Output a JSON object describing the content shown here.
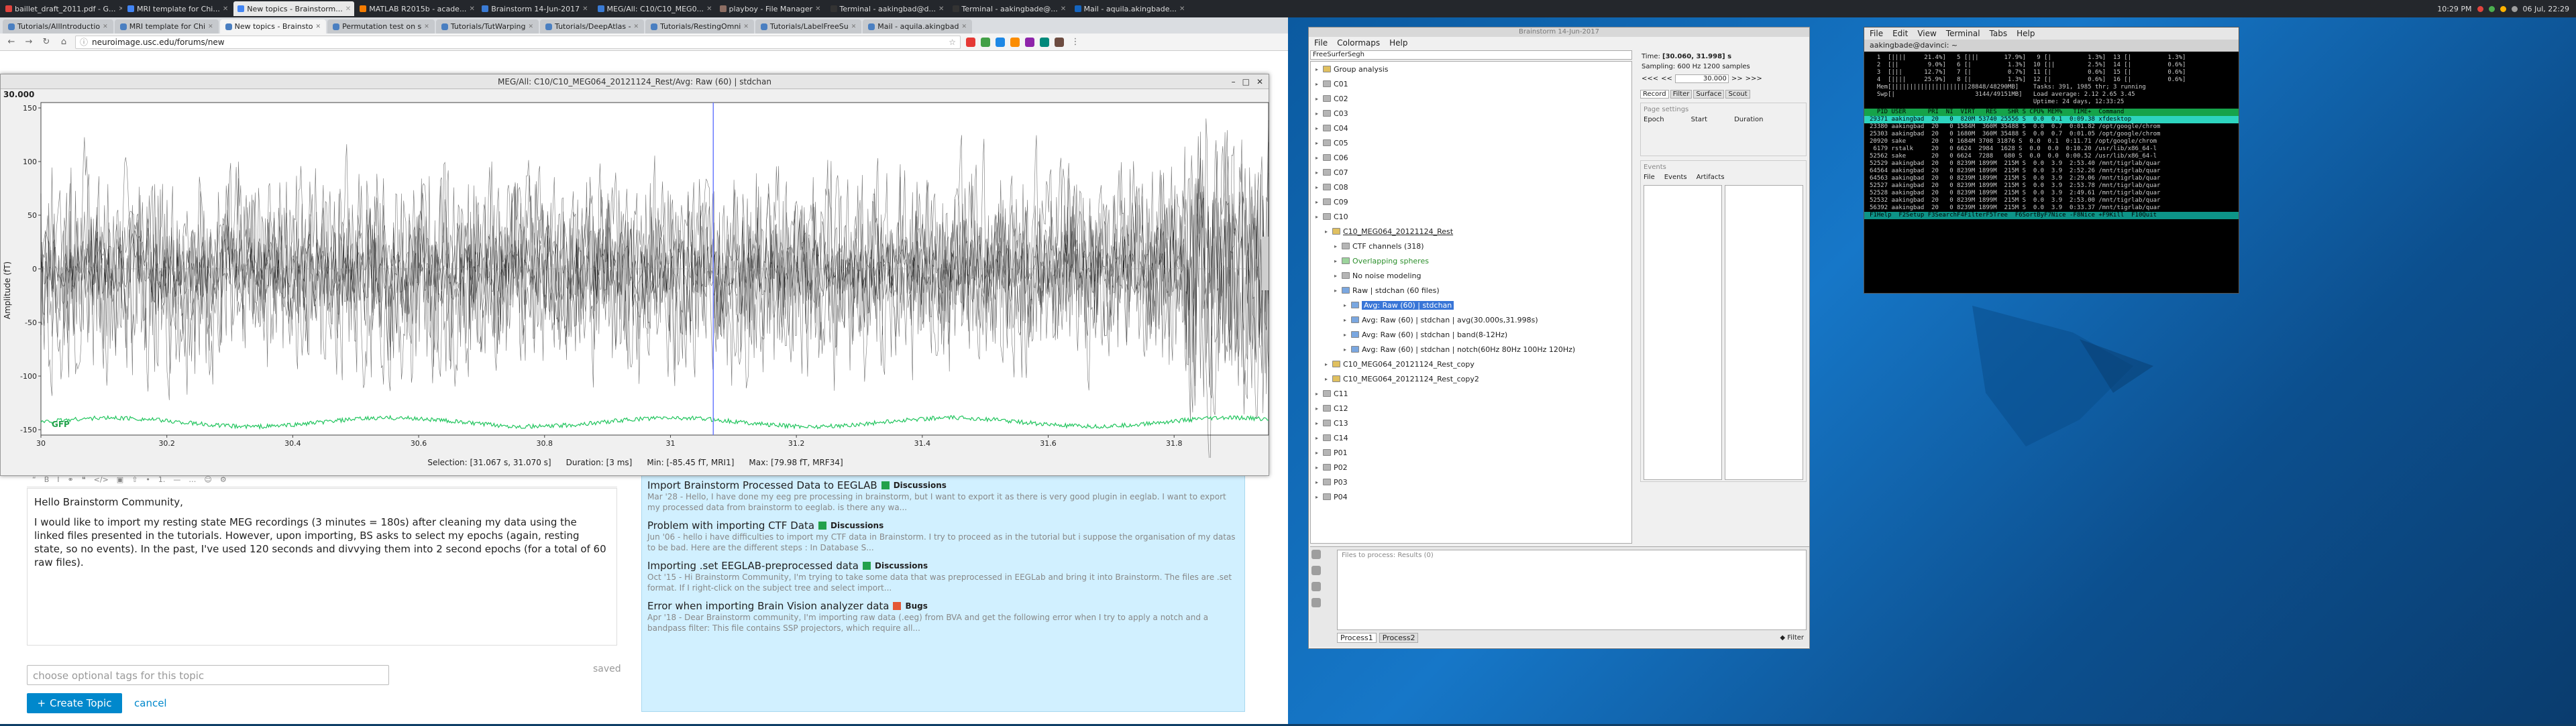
{
  "taskbar": {
    "tabs": [
      {
        "label": "baillet_draft_2011.pdf - G...",
        "color": "#e0443e",
        "active": false
      },
      {
        "label": "MRI template for Chi...",
        "color": "#4285f4",
        "active": false
      },
      {
        "label": "New topics - Brainstorm...",
        "color": "#4285f4",
        "active": true
      },
      {
        "label": "MATLAB R2015b - acade...",
        "color": "#f57c00",
        "active": false
      },
      {
        "label": "Brainstorm 14-Jun-2017",
        "color": "#3a7bd5",
        "active": false
      },
      {
        "label": "MEG/All: C10/C10_MEG0...",
        "color": "#3a7bd5",
        "active": false
      },
      {
        "label": "playboy - File Manager",
        "color": "#8d6e63",
        "active": false
      },
      {
        "label": "Terminal - aakingbad@d...",
        "color": "#333333",
        "active": false
      },
      {
        "label": "Terminal - aakingbade@...",
        "color": "#333333",
        "active": false
      },
      {
        "label": "Mail - aquila.akingbade...",
        "color": "#1565c0",
        "active": false
      }
    ],
    "clock": "10:29 PM",
    "date": "06 Jul, 22:29"
  },
  "browser": {
    "tabs": [
      "Tutorials/AllIntroductio",
      "MRI template for Chi",
      "New topics - Brainsto",
      "Permutation test on s",
      "Tutorials/TutWarping",
      "Tutorials/DeepAtlas -",
      "Tutorials/RestingOmni",
      "Tutorials/LabelFreeSu",
      "Mail - aquila.akingbad"
    ],
    "active_tab": 2,
    "url": "neuroimage.usc.edu/forums/new"
  },
  "meg_window": {
    "title": "MEG/All: C10/C10_MEG064_20121124_Rest/Avg: Raw (60) | stdchan",
    "y_top_label": "30.000",
    "ylabel": "Amplitude (fT)",
    "gfp_label": "GFP",
    "status": {
      "selection": "Selection: [31.067 s, 31.070 s]",
      "duration": "Duration: [3 ms]",
      "min": "Min: [-85.45 fT, MRI1]",
      "max": "Max: [79.98 fT, MRF34]"
    }
  },
  "chart_data": {
    "type": "line",
    "title": "",
    "xlabel": "",
    "ylabel": "Amplitude (fT)",
    "xlim": [
      30.0,
      31.95
    ],
    "ylim": [
      -155,
      155
    ],
    "x_ticks": [
      30,
      30.2,
      30.4,
      30.6,
      30.8,
      31,
      31.2,
      31.4,
      31.6,
      31.8
    ],
    "y_ticks": [
      -150,
      -100,
      -50,
      0,
      50,
      100,
      150
    ],
    "cursor_x": 31.068,
    "series": [
      {
        "name": "Raw (60) | stdchan",
        "color": "#000000"
      },
      {
        "name": "GFP",
        "color": "#22c55e"
      }
    ]
  },
  "forum": {
    "toolbar_icons": [
      "quote",
      "bold",
      "italic",
      "link",
      "blockquote",
      "code",
      "image",
      "upload",
      "bullets",
      "numbers",
      "hr",
      "more",
      "emoji",
      "gear"
    ],
    "post_paragraphs": [
      "Hello Brainstorm Community,",
      "I would like to import my resting state MEG recordings (3 minutes = 180s) after cleaning my data using the linked files presented in the tutorials. However, upon importing, BS asks to select my epochs (again, resting state, so no events). In the past, I've used 120 seconds and divvying them into 2 second epochs (for a total of 60 raw files)."
    ],
    "tags_placeholder": "choose optional tags for this topic",
    "saved_label": "saved",
    "create_label": "Create Topic",
    "cancel_label": "cancel",
    "similar_topics": [
      {
        "title": "Import Brainstorm Processed Data to EEGLAB",
        "category": "Discussions",
        "cat_color": "#22a14b",
        "body": "Mar '28 - Hello, I have done my eeg pre processing in brainstorm, but I want to export it as there is very good plugin in eeglab. I want to export my processed data from brainstorm to eeglab. is there any wa..."
      },
      {
        "title": "Problem with importing CTF Data",
        "category": "Discussions",
        "cat_color": "#22a14b",
        "body": "Jun '06 - hello i have difficulties to import my CTF data in Brainstorm. I try to proceed as in the tutorial but i suppose the organisation of my datas to be bad. Here are the different steps : In Database S..."
      },
      {
        "title": "Importing .set EEGLAB-preprocessed data",
        "category": "Discussions",
        "cat_color": "#22a14b",
        "body": "Oct '15 - Hi Brainstorm Community, I'm trying to take some data that was preprocessed in EEGLab and bring it into Brainstorm. The files are .set format. If I right-click on the subject tree and select import..."
      },
      {
        "title": "Error when importing Brain Vision analyzer data",
        "category": "Bugs",
        "cat_color": "#e45735",
        "body": "Apr '18 - Dear Brainstorm community, I'm importing raw data (.eeg) from BVA and get the following error when I try to apply a notch and a bandpass filter: This file contains SSP projectors, which require all..."
      }
    ]
  },
  "brainstorm": {
    "title": "Brainstorm 14-Jun-2017",
    "menu": [
      "File",
      "Colormaps",
      "Help"
    ],
    "protocol": "FreeSurferSegh",
    "tree": [
      {
        "label": "Group analysis",
        "icon": "folder"
      },
      {
        "label": "C01",
        "icon": "subject"
      },
      {
        "label": "C02",
        "icon": "subject"
      },
      {
        "label": "C03",
        "icon": "subject"
      },
      {
        "label": "C04",
        "icon": "subject"
      },
      {
        "label": "C05",
        "icon": "subject"
      },
      {
        "label": "C06",
        "icon": "subject"
      },
      {
        "label": "C07",
        "icon": "subject"
      },
      {
        "label": "C08",
        "icon": "subject"
      },
      {
        "label": "C09",
        "icon": "subject"
      },
      {
        "label": "C10",
        "icon": "subject"
      },
      {
        "label": "C10_MEG064_20121124_Rest",
        "icon": "folder",
        "underline": true
      },
      {
        "label": "CTF channels (318)",
        "icon": "channel"
      },
      {
        "label": "Overlapping spheres",
        "icon": "head",
        "green": true
      },
      {
        "label": "No noise modeling",
        "icon": "noise"
      },
      {
        "label": "Raw  |  stdchan (60 files)",
        "icon": "data"
      },
      {
        "label": "Avg: Raw (60) | stdchan",
        "icon": "data",
        "selected": true
      },
      {
        "label": "Avg: Raw (60) | stdchan | avg(30.000s,31.998s)",
        "icon": "data"
      },
      {
        "label": "Avg: Raw (60) | stdchan | band(8-12Hz)",
        "icon": "data"
      },
      {
        "label": "Avg: Raw (60) | stdchan | notch(60Hz 80Hz 100Hz 120Hz)",
        "icon": "data"
      },
      {
        "label": "C10_MEG064_20121124_Rest_copy",
        "icon": "folder"
      },
      {
        "label": "C10_MEG064_20121124_Rest_copy2",
        "icon": "folder"
      },
      {
        "label": "C11",
        "icon": "subject"
      },
      {
        "label": "C12",
        "icon": "subject"
      },
      {
        "label": "C13",
        "icon": "subject"
      },
      {
        "label": "C14",
        "icon": "subject"
      },
      {
        "label": "P01",
        "icon": "subject"
      },
      {
        "label": "P02",
        "icon": "subject"
      },
      {
        "label": "P03",
        "icon": "subject"
      },
      {
        "label": "P04",
        "icon": "subject"
      }
    ],
    "time_label": "Time:",
    "time_value": "[30.060, 31.998] s",
    "sampling": "Sampling: 600 Hz     1200 samples",
    "time_step": "30.000",
    "tabs_right": [
      "Record",
      "Filter",
      "Surface",
      "Scout"
    ],
    "page_settings": "Page settings",
    "epoch_labels": [
      "Epoch",
      "Start",
      "Duration"
    ],
    "events_label": "Events",
    "events_menu": [
      "File",
      "Events",
      "Artifacts"
    ],
    "process_title": "Files to process: Results (0)",
    "process_tabs": [
      "Process1",
      "Process2"
    ],
    "filter_label": "Filter"
  },
  "terminal": {
    "tab_title": "aakingbade@davinci: ~",
    "menu": [
      "File",
      "Edit",
      "View",
      "Terminal",
      "Tabs",
      "Help"
    ],
    "lines": [
      "  1  [||||     21.4%]   5 [|||       17.9%]   9 [|          1.3%]  13 [|          1.3%]",
      "  2  [||        9.0%]   6 [|          1.3%]  10 [||         2.5%]  14 [|          0.6%]",
      "  3  [|||      12.7%]   7 [|          0.7%]  11 [|          0.6%]  15 [|          0.6%]",
      "  4  [||||     25.9%]   8 [|          1.3%]  12 [|          0.6%]  16 [|          0.6%]",
      "  Mem[|||||||||||||||||||||28848/48290MB]    Tasks: 391, 1985 thr; 3 running",
      "  Swp[|                      3144/49151MB]   Load average: 2.12 2.65 3.45",
      "                                             Uptime: 24 days, 12:33:25"
    ],
    "header": "  PID USER      PRI  NI  VIRT   RES   SHR S CPU% MEM%   TIME+  Command",
    "procs": [
      "29371 aakingbad  20   0  820M 53740 25556 S  0.0  0.1  0:09.38 xfdesktop",
      "23380 aakingbad  20   0 1584M  360M 35488 S  0.0  0.7  0:01.82 /opt/google/chrom",
      "25303 aakingbad  20   0 1680M  360M 35488 S  0.0  0.7  0:01.05 /opt/google/chrom",
      "20920 sake       20   0 1684M 3708 31876 S  0.0  0.1  0:11.71 /opt/google/chrom",
      " 6179 rstalk     20   0 6624  2984  1628 S  0.0  0.0  0:10.20 /usr/lib/x86_64-l",
      "52562 sake       20   0 6624  7288   680 S  0.0  0.0  0:00.52 /usr/lib/x86_64-l",
      "52529 aakingbad  20   0 8239M 1899M  215M S  0.0  3.9  2:53.40 /mnt/tigrlab/quar",
      "64564 aakingbad  20   0 8239M 1899M  215M S  0.0  3.9  2:52.26 /mnt/tigrlab/quar",
      "64563 aakingbad  20   0 8239M 1899M  215M S  0.0  3.9  2:29.06 /mnt/tigrlab/quar",
      "52527 aakingbad  20   0 8239M 1899M  215M S  0.0  3.9  2:53.78 /mnt/tigrlab/quar",
      "52528 aakingbad  20   0 8239M 1899M  215M S  0.0  3.9  2:49.61 /mnt/tigrlab/quar",
      "52532 aakingbad  20   0 8239M 1899M  215M S  0.0  3.9  2:53.00 /mnt/tigrlab/quar",
      "56392 aakingbad  20   0 8239M 1899M  215M S  0.0  3.9  0:33.37 /mnt/tigrlab/quar"
    ],
    "footer": "F1Help  F2Setup F3SearchF4FilterF5Tree  F6SortByF7Nice -F8Nice +F9Kill  F10Quit"
  }
}
